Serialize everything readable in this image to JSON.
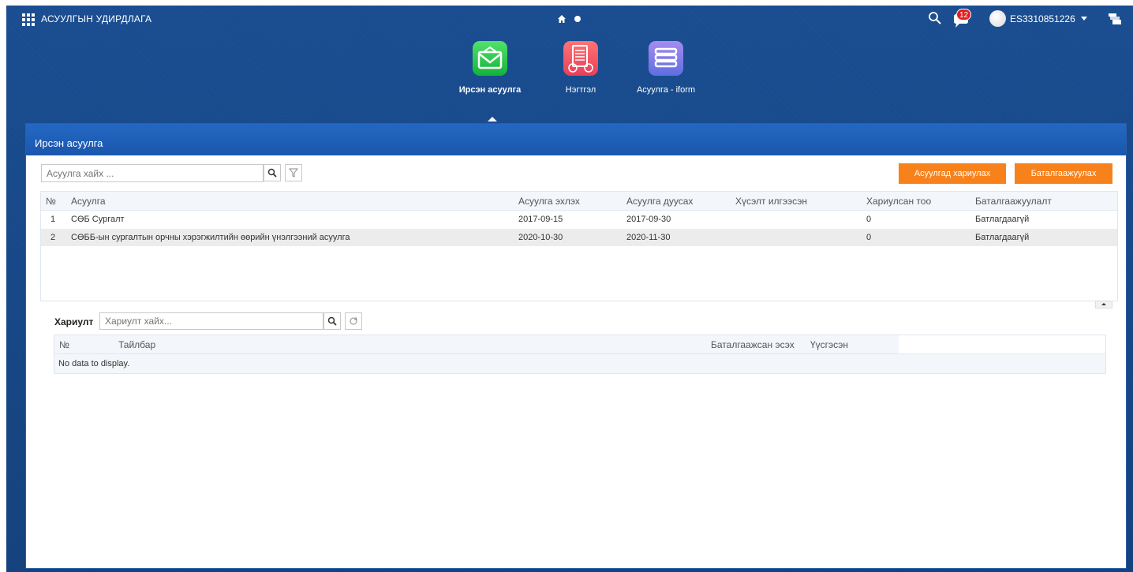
{
  "topbar": {
    "app_title": "АСУУЛГЫН УДИРДЛАГА",
    "notification_count": "12",
    "username": "ES3310851226"
  },
  "modules": [
    {
      "label": "Ирсэн асуулга",
      "icon": "mail-icon",
      "color": "#14b23b",
      "active": true
    },
    {
      "label": "Нэгтгэл",
      "icon": "report-icon",
      "color": "#e7405a",
      "active": false
    },
    {
      "label": "Асуулга - iform",
      "icon": "stack-icon",
      "color": "#5e6ee0",
      "active": false
    }
  ],
  "panel": {
    "title": "Ирсэн асуулга",
    "search_placeholder": "Асуулга хайх ...",
    "reply_button": "Асуулгад хариулах",
    "confirm_button": "Баталгаажуулах",
    "columns": [
      "№",
      "Асуулга",
      "Асуулга эхлэх",
      "Асуулга дуусах",
      "Хүсэлт илгээсэн",
      "Хариулсан тоо",
      "Баталгаажуулалт"
    ],
    "rows": [
      {
        "no": "1",
        "name": "СӨБ Сургалт",
        "start": "2017-09-15",
        "end": "2017-09-30",
        "sent": "",
        "answered": "0",
        "status": "Батлагдаагүй"
      },
      {
        "no": "2",
        "name": "СӨББ-ын сургалтын орчны хэрэгжилтийн өөрийн үнэлгээний асуулга",
        "start": "2020-10-30",
        "end": "2020-11-30",
        "sent": "",
        "answered": "0",
        "status": "Батлагдаагүй"
      }
    ]
  },
  "answers": {
    "label": "Хариулт",
    "search_placeholder": "Хариулт хайх...",
    "columns": [
      "№",
      "Тайлбар",
      "Баталгаажсан эсэх",
      "Үүсгэсэн"
    ],
    "empty_text": "No data to display."
  },
  "colors": {
    "header_bg": "#15427f",
    "accent_orange": "#f7821b",
    "panel_header": "#1f5fb8",
    "badge_red": "#e41e1e"
  }
}
